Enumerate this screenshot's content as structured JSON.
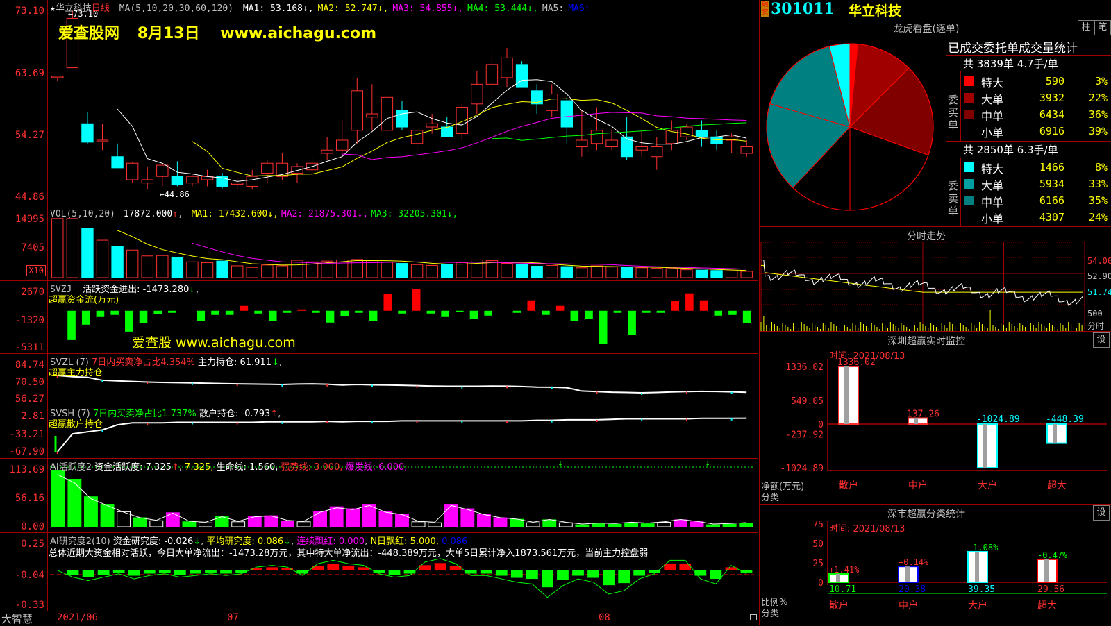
{
  "stock": {
    "code": "301011",
    "name": "华立科技",
    "rz_badge": "融资",
    "star": "★",
    "period": "日线"
  },
  "watermark": {
    "line1_site": "爱查股网",
    "line1_date": "8月13日",
    "line1_url": "www.aichagu.com",
    "line2": "爱查股 www.aichagu.com"
  },
  "price_panel": {
    "ma_header": "MA(5,10,20,30,60,120)",
    "ma_values": [
      {
        "label": "MA1: 53.168",
        "arrow": "↓",
        "color": "#ffffff"
      },
      {
        "label": "MA2: 52.747",
        "arrow": "↓",
        "color": "#ffff00"
      },
      {
        "label": "MA3: 54.855",
        "arrow": "↓",
        "color": "#ff00ff"
      },
      {
        "label": "MA4: 53.444",
        "arrow": "↓",
        "color": "#00ff00"
      },
      {
        "label": "MA5:",
        "arrow": "",
        "color": "#c0c0c0"
      },
      {
        "label": "MA6:",
        "arrow": "",
        "color": "#0000ff"
      }
    ],
    "yaxis": [
      "73.10",
      "63.69",
      "54.27",
      "44.86"
    ],
    "high_label": "73.10",
    "low_label": "44.86",
    "candles": [
      [
        63.0,
        63.3,
        62.5,
        63.2
      ],
      [
        64.5,
        73.1,
        64.5,
        72.0
      ],
      [
        56.0,
        57.8,
        53.0,
        53.2
      ],
      [
        53.3,
        56.0,
        52.0,
        53.5
      ],
      [
        51.0,
        53.0,
        49.5,
        49.3
      ],
      [
        47.5,
        50.2,
        47.0,
        50.0
      ],
      [
        47.0,
        49.5,
        46.0,
        47.5
      ],
      [
        48.0,
        50.0,
        46.5,
        49.7
      ],
      [
        48.0,
        50.3,
        46.5,
        46.7
      ],
      [
        47.0,
        48.2,
        46.5,
        48.0
      ],
      [
        47.5,
        49.0,
        46.5,
        48.0
      ],
      [
        48.0,
        48.5,
        46.2,
        46.5
      ],
      [
        46.8,
        47.8,
        46.0,
        47.0
      ],
      [
        46.5,
        49.0,
        46.0,
        48.0
      ],
      [
        48.5,
        50.5,
        47.0,
        50.0
      ],
      [
        48.0,
        51.5,
        47.5,
        50.0
      ],
      [
        48.5,
        50.0,
        47.0,
        49.5
      ],
      [
        49.0,
        51.0,
        48.0,
        50.0
      ],
      [
        51.5,
        54.0,
        50.5,
        52.0
      ],
      [
        52.0,
        56.5,
        51.0,
        53.5
      ],
      [
        55.0,
        63.0,
        53.0,
        61.0
      ],
      [
        57.0,
        62.0,
        55.0,
        57.5
      ],
      [
        55.0,
        60.0,
        53.5,
        60.0
      ],
      [
        58.0,
        59.5,
        55.0,
        55.5
      ],
      [
        53.0,
        55.0,
        52.0,
        55.0
      ],
      [
        55.5,
        57.5,
        54.5,
        56.0
      ],
      [
        55.5,
        57.0,
        54.5,
        54.0
      ],
      [
        54.5,
        59.0,
        53.5,
        58.5
      ],
      [
        59.0,
        64.0,
        57.5,
        62.0
      ],
      [
        62.0,
        67.0,
        60.0,
        65.0
      ],
      [
        63.0,
        67.5,
        61.5,
        66.0
      ],
      [
        65.0,
        65.5,
        61.5,
        61.5
      ],
      [
        61.0,
        62.0,
        57.5,
        59.0
      ],
      [
        58.0,
        62.0,
        57.0,
        60.5
      ],
      [
        59.5,
        60.0,
        53.0,
        55.5
      ],
      [
        52.5,
        58.0,
        51.0,
        53.5
      ],
      [
        53.0,
        58.5,
        52.0,
        55.0
      ],
      [
        52.5,
        55.0,
        52.0,
        53.5
      ],
      [
        54.0,
        57.0,
        50.5,
        51.0
      ],
      [
        52.0,
        55.0,
        51.0,
        52.5
      ],
      [
        51.0,
        54.0,
        49.0,
        52.5
      ],
      [
        53.0,
        56.5,
        52.0,
        55.0
      ],
      [
        54.0,
        56.0,
        53.5,
        55.5
      ],
      [
        55.0,
        56.5,
        52.5,
        54.0
      ],
      [
        54.0,
        55.0,
        52.0,
        53.0
      ],
      [
        53.5,
        54.5,
        51.5,
        54.0
      ],
      [
        51.5,
        53.5,
        51.0,
        52.5
      ]
    ],
    "xlabels": [
      "2021/06",
      "07",
      "08"
    ],
    "footer_left": "大智慧"
  },
  "vol_panel": {
    "header": "VOL(5,10,20)",
    "vol_value": "17872.000",
    "mas": [
      {
        "label": "MA1: 17432.600",
        "arrow": "↓",
        "color": "#ffff00"
      },
      {
        "label": "MA2: 21875.301",
        "arrow": "↓",
        "color": "#ff00ff"
      },
      {
        "label": "MA3: 32205.301",
        "arrow": "↓",
        "color": "#00ff00"
      }
    ],
    "yaxis": [
      "14995",
      "7405"
    ],
    "unit": "X10",
    "volumes": [
      15000,
      15000,
      12500,
      9500,
      8000,
      7000,
      5500,
      5600,
      5200,
      4000,
      3800,
      4200,
      3000,
      2600,
      3200,
      3000,
      4400,
      4000,
      4200,
      4500,
      4600,
      4300,
      3900,
      3600,
      3300,
      3100,
      3300,
      3800,
      4500,
      4300,
      3600,
      3300,
      2900,
      3100,
      2800,
      2500,
      3000,
      2700,
      2600,
      2500,
      2400,
      2300,
      2000,
      1900,
      1800,
      1700,
      1600
    ]
  },
  "svzj_panel": {
    "header": "SVZJ",
    "label": "活跃资金进出: -1473.280",
    "sub": "超赢资金流(万元)",
    "yaxis": [
      "2670",
      "-1320",
      "-5311"
    ],
    "values": [
      0,
      -4200,
      -2000,
      -900,
      -600,
      -3000,
      -1800,
      -500,
      -300,
      0,
      -1500,
      -600,
      -600,
      700,
      -400,
      -1500,
      -300,
      200,
      -300,
      -1700,
      -800,
      -300,
      -1500,
      2400,
      -400,
      3100,
      -400,
      -900,
      -200,
      -1200,
      -700,
      0,
      -300,
      1500,
      -600,
      700,
      -1500,
      -1200,
      -4800,
      -300,
      -3500,
      -300,
      -300,
      1400,
      2500,
      1500,
      -700,
      -600,
      -1800
    ]
  },
  "svzl_panel": {
    "header": "SVZL",
    "n": "(7)",
    "ratio_label": "7日内买卖净占比4.354%",
    "hold_label": "主力持仓: 61.911",
    "sub": "超赢主力持仓",
    "yaxis": [
      "84.74",
      "70.50",
      "56.27"
    ],
    "line": [
      76,
      75,
      74.5,
      72,
      71.5,
      71,
      70.5,
      70.2,
      70,
      69.8,
      69.5,
      69.2,
      69,
      68.8,
      68.7,
      68.5,
      68.8,
      69,
      68.7,
      68,
      68.5,
      68.2,
      68,
      67.8,
      67.5,
      67.2,
      67,
      67,
      67,
      67.2,
      67.1,
      66.8,
      66.3,
      66.2,
      65.8,
      63,
      62.5,
      62,
      61.8,
      61.5,
      61.8,
      62.2,
      62.5,
      62.7,
      62.6,
      62.3,
      61.9
    ]
  },
  "svsh_panel": {
    "header": "SVSH",
    "n": "(7)",
    "ratio_label": "7日内买卖净占比1.737%",
    "hold_label": "散户持仓: -0.793",
    "sub": "超赢散户持仓",
    "yaxis": [
      "2.81",
      "-33.21",
      "-67.90"
    ],
    "line": [
      -67.9,
      -32,
      -28,
      -24,
      -14,
      -10,
      -10,
      -10,
      -9,
      -9,
      -9,
      -9,
      -9,
      -9,
      -8,
      -8,
      -8,
      -8,
      -7,
      -8,
      -7,
      -7,
      -7,
      -6,
      -6,
      -6,
      -6,
      -6,
      -6,
      -6,
      -6,
      -6,
      -5,
      -5,
      -4,
      -4,
      -4,
      -3,
      -2,
      -2,
      -2,
      -2,
      -2,
      -1,
      -1,
      -1,
      -0.8
    ]
  },
  "ai_active_panel": {
    "header": "AI活跃度2",
    "label": "资金活跃度: 7.325",
    "label2": "7.325,",
    "life": "生命线: 1.560,",
    "strong": "强势线: 3.000,",
    "burst": "爆发线: 6.000,",
    "yaxis": [
      "113.69",
      "56.16",
      "0.00"
    ],
    "bars": [
      [
        113,
        "g"
      ],
      [
        95,
        "g"
      ],
      [
        60,
        "g"
      ],
      [
        45,
        "g"
      ],
      [
        30,
        "o"
      ],
      [
        18,
        "g"
      ],
      [
        12,
        "o"
      ],
      [
        28,
        "m"
      ],
      [
        10,
        "g"
      ],
      [
        8,
        "o"
      ],
      [
        20,
        "g"
      ],
      [
        10,
        "o"
      ],
      [
        20,
        "m"
      ],
      [
        22,
        "m"
      ],
      [
        12,
        "m"
      ],
      [
        10,
        "o"
      ],
      [
        30,
        "m"
      ],
      [
        40,
        "m"
      ],
      [
        36,
        "m"
      ],
      [
        45,
        "m"
      ],
      [
        30,
        "m"
      ],
      [
        25,
        "m"
      ],
      [
        10,
        "o"
      ],
      [
        8,
        "o"
      ],
      [
        45,
        "m"
      ],
      [
        36,
        "m"
      ],
      [
        25,
        "m"
      ],
      [
        18,
        "m"
      ],
      [
        15,
        "g"
      ],
      [
        8,
        "o"
      ],
      [
        14,
        "g"
      ],
      [
        8,
        "o"
      ],
      [
        4,
        "g"
      ],
      [
        6,
        "g"
      ],
      [
        5,
        "g"
      ],
      [
        8,
        "g"
      ],
      [
        6,
        "g"
      ],
      [
        9,
        "o"
      ],
      [
        14,
        "m"
      ],
      [
        10,
        "m"
      ],
      [
        4,
        "g"
      ],
      [
        5,
        "g"
      ],
      [
        7,
        "g"
      ]
    ]
  },
  "ai_research_panel": {
    "header": "AI研究度2(10)",
    "label": "资金研究度: -0.026",
    "avg": "平均研究度: 0.086",
    "cont": "连续飘红: 0.000",
    "nday": "N日飘红: 5.000,",
    "last": "0.086",
    "summary": "总体近期大资金相对活跃，今日大单净流出：-1473.28万元，其中特大单净流出：-448.389万元，大单5日累计净入1873.561万元，当前主力控盘弱",
    "yaxis": [
      "0.25",
      "-0.04",
      "-0.33"
    ],
    "bars": [
      0,
      -0.04,
      -0.06,
      -0.04,
      -0.02,
      -0.05,
      -0.03,
      -0.02,
      -0.04,
      -0.03,
      -0.02,
      -0.03,
      -0.02,
      0.02,
      0.03,
      0.02,
      -0.03,
      0.04,
      0.06,
      0.04,
      0.03,
      -0.02,
      -0.04,
      -0.03,
      0.05,
      0.07,
      0.04,
      -0.03,
      -0.03,
      -0.05,
      -0.07,
      -0.08,
      -0.16,
      -0.09,
      -0.05,
      -0.07,
      -0.14,
      -0.12,
      -0.05,
      -0.02,
      0.06,
      0.06,
      -0.05,
      -0.08,
      0.03,
      -0.02
    ]
  },
  "longhu": {
    "title": "龙虎看盘(逐单)",
    "btn1": "柱",
    "btn2": "笔",
    "stat_title": "已成交委托单成交量统计",
    "buy_total": "共 3839单 4.7手/单",
    "sell_total": "共 2850单 6.3手/单",
    "buy_label": "委买单",
    "sell_label": "委卖单",
    "buy": [
      {
        "name": "特大",
        "vol": "590",
        "pct": "3%",
        "color": "#ff0000"
      },
      {
        "name": "大单",
        "vol": "3932",
        "pct": "22%",
        "color": "#a00000"
      },
      {
        "name": "中单",
        "vol": "6434",
        "pct": "36%",
        "color": "#800000"
      },
      {
        "name": "小单",
        "vol": "6916",
        "pct": "39%",
        "color": "#000000"
      }
    ],
    "sell": [
      {
        "name": "特大",
        "vol": "1466",
        "pct": "8%",
        "color": "#00ffff"
      },
      {
        "name": "大单",
        "vol": "5934",
        "pct": "33%",
        "color": "#00a0a0"
      },
      {
        "name": "中单",
        "vol": "6166",
        "pct": "35%",
        "color": "#008080"
      },
      {
        "name": "小单",
        "vol": "4307",
        "pct": "24%",
        "color": "#000000"
      }
    ],
    "pie": [
      {
        "pct": 1.5,
        "color": "#ff0000"
      },
      {
        "pct": 11,
        "color": "#a00000"
      },
      {
        "pct": 18,
        "color": "#800000"
      },
      {
        "pct": 19.5,
        "color": "#000000"
      },
      {
        "pct": 12,
        "color": "#000000"
      },
      {
        "pct": 17.5,
        "color": "#008080"
      },
      {
        "pct": 16.5,
        "color": "#008080"
      },
      {
        "pct": 4,
        "color": "#00ffff"
      }
    ]
  },
  "intraday": {
    "title": "分时走势",
    "yaxis": [
      "54.06",
      "52.90",
      "51.74"
    ],
    "vol_label": "500",
    "fen_label": "分时"
  },
  "sz_monitor": {
    "title": "深圳超赢实时监控",
    "btn": "设",
    "time": "时间: 2021/08/13",
    "yaxis": [
      "1336.02",
      "549.05",
      "0",
      "-237.92",
      "-1024.89"
    ],
    "ylabel1": "净额(万元)",
    "ylabel2": "分类",
    "bars": [
      {
        "cat": "散户",
        "value": 1336.02,
        "label": "1336.02"
      },
      {
        "cat": "中户",
        "value": 137.26,
        "label": "137.26"
      },
      {
        "cat": "大户",
        "value": -1024.89,
        "label": "-1024.89"
      },
      {
        "cat": "超大",
        "value": -448.39,
        "label": "-448.39"
      }
    ]
  },
  "sz_class": {
    "title": "深市超赢分类统计",
    "btn": "设",
    "time": "时间: 2021/08/13",
    "yaxis": [
      "75",
      "50",
      "25",
      "0"
    ],
    "ylabel1": "比例%",
    "ylabel2": "分类",
    "bars": [
      {
        "cat": "散户",
        "value": 10.71,
        "label": "10.71",
        "delta": "+1.41%",
        "color": "#00ff00"
      },
      {
        "cat": "中户",
        "value": 20.38,
        "label": "20.38",
        "delta": "+0.14%",
        "color": "#0000ff"
      },
      {
        "cat": "大户",
        "value": 39.35,
        "label": "39.35",
        "delta": "-1.08%",
        "color": "#00ffff"
      },
      {
        "cat": "超大",
        "value": 29.56,
        "label": "29.56",
        "delta": "-0.47%",
        "color": "#ff0000"
      }
    ]
  },
  "colors": {
    "up": "#ff3030",
    "down": "#00ffff",
    "grid": "#a00000"
  }
}
